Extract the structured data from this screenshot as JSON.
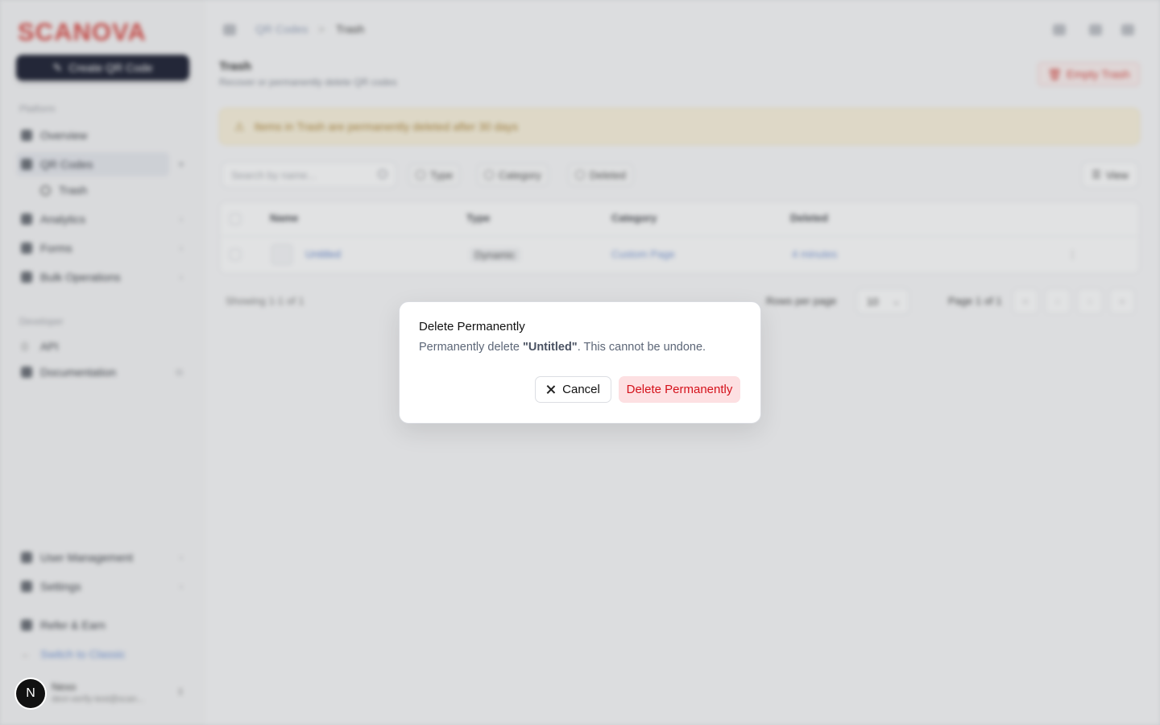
{
  "sidebar": {
    "logo": "SCANOVA",
    "create_label": "Create QR Code",
    "section_platform": "Platform",
    "items": [
      {
        "label": "Overview"
      },
      {
        "label": "QR Codes"
      },
      {
        "label": "Trash"
      },
      {
        "label": "Analytics"
      },
      {
        "label": "Forms"
      },
      {
        "label": "Bulk Operations"
      }
    ],
    "section_developer": "Developer",
    "dev_items": [
      {
        "label": "API"
      },
      {
        "label": "Documentation"
      }
    ],
    "bottom_items": [
      {
        "label": "User Management"
      },
      {
        "label": "Settings"
      },
      {
        "label": "Refer & Earn"
      },
      {
        "label": "Switch to Classic"
      }
    ],
    "user": {
      "initial": "N",
      "name": "Nexo",
      "email": "devi-verify-test@scan..."
    }
  },
  "header": {
    "breadcrumb_parent": "QR Codes",
    "breadcrumb_separator": ">",
    "breadcrumb_current": "Trash"
  },
  "page": {
    "title": "Trash",
    "subtitle": "Recover or permanently delete QR codes",
    "empty_trash_label": "Empty Trash",
    "banner_text": "Items in Trash are permanently deleted after 30 days"
  },
  "toolbar": {
    "search_placeholder": "Search by name...",
    "filters": [
      "Type",
      "Category",
      "Deleted"
    ],
    "view_label": "View"
  },
  "table": {
    "headers": [
      "Name",
      "Type",
      "Category",
      "Deleted"
    ],
    "rows": [
      {
        "name": "Untitled",
        "type": "Dynamic",
        "category": "Custom Page",
        "deleted": "4 minutes"
      }
    ]
  },
  "pagination": {
    "showing": "Showing 1-1 of 1",
    "rows_per_page_label": "Rows per page",
    "rows_per_page_value": "10",
    "page_label": "Page 1 of 1"
  },
  "dialog": {
    "title": "Delete Permanently",
    "desc_prefix": "Permanently delete ",
    "desc_item": "\"Untitled\"",
    "desc_suffix": ". This cannot be undone.",
    "cancel_label": "Cancel",
    "confirm_label": "Delete Permanently"
  },
  "colors": {
    "brand": "#d8403a",
    "danger": "#d4111b",
    "danger_bg": "#fde0e2"
  }
}
